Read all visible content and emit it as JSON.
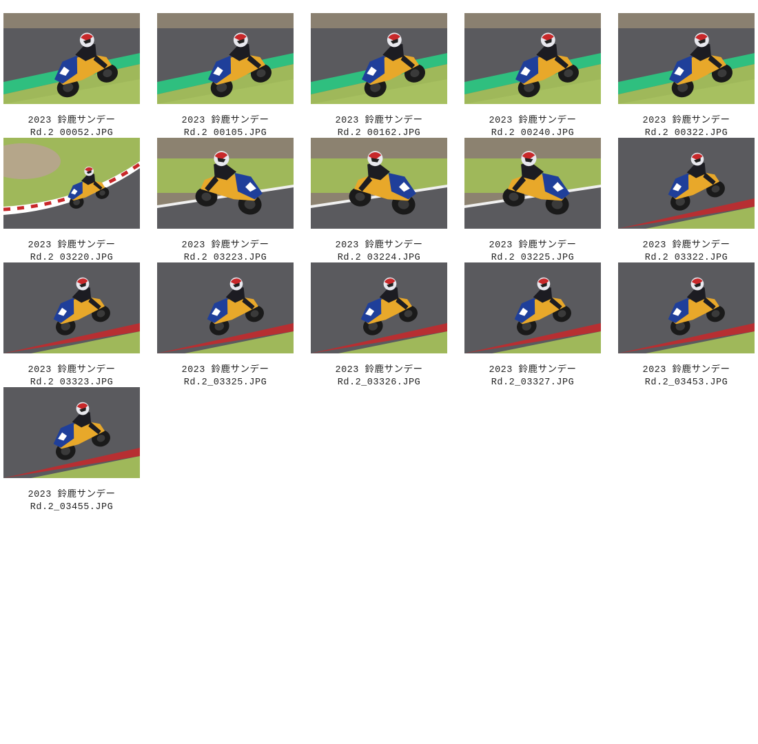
{
  "gallery": {
    "items": [
      {
        "title": "2023 鈴鹿サンデー",
        "file": "Rd.2 00052.JPG",
        "scene": "track-green-kerb-left",
        "lean": "left"
      },
      {
        "title": "2023 鈴鹿サンデー",
        "file": "Rd.2 00105.JPG",
        "scene": "track-green-kerb-left",
        "lean": "left"
      },
      {
        "title": "2023 鈴鹿サンデー",
        "file": "Rd.2 00162.JPG",
        "scene": "track-green-kerb-left",
        "lean": "left"
      },
      {
        "title": "2023 鈴鹿サンデー",
        "file": "Rd.2 00240.JPG",
        "scene": "track-green-kerb-left",
        "lean": "left"
      },
      {
        "title": "2023 鈴鹿サンデー",
        "file": "Rd.2 00322.JPG",
        "scene": "track-green-kerb-left",
        "lean": "left"
      },
      {
        "title": "2023 鈴鹿サンデー",
        "file": "Rd.2 03220.JPG",
        "scene": "grass-corner-red-kerb",
        "lean": "left"
      },
      {
        "title": "2023 鈴鹿サンデー",
        "file": "Rd.2 03223.JPG",
        "scene": "grass-track-side",
        "lean": "right"
      },
      {
        "title": "2023 鈴鹿サンデー",
        "file": "Rd.2 03224.JPG",
        "scene": "grass-track-side",
        "lean": "right"
      },
      {
        "title": "2023 鈴鹿サンデー",
        "file": "Rd.2 03225.JPG",
        "scene": "grass-track-side",
        "lean": "right"
      },
      {
        "title": "2023 鈴鹿サンデー",
        "file": "Rd.2 03322.JPG",
        "scene": "asphalt-red-kerb",
        "lean": "left"
      },
      {
        "title": "2023 鈴鹿サンデー",
        "file": "Rd.2 03323.JPG",
        "scene": "asphalt-red-kerb",
        "lean": "left"
      },
      {
        "title": "2023 鈴鹿サンデー",
        "file": "Rd.2_03325.JPG",
        "scene": "asphalt-red-kerb",
        "lean": "left"
      },
      {
        "title": "2023 鈴鹿サンデー",
        "file": "Rd.2_03326.JPG",
        "scene": "asphalt-red-kerb",
        "lean": "left"
      },
      {
        "title": "2023 鈴鹿サンデー",
        "file": "Rd.2_03327.JPG",
        "scene": "asphalt-red-kerb",
        "lean": "left"
      },
      {
        "title": "2023 鈴鹿サンデー",
        "file": "Rd.2_03453.JPG",
        "scene": "asphalt-red-kerb",
        "lean": "left"
      },
      {
        "title": "2023 鈴鹿サンデー",
        "file": "Rd.2_03455.JPG",
        "scene": "asphalt-red-kerb",
        "lean": "left"
      }
    ]
  },
  "colors": {
    "asphalt": "#5a5a5e",
    "grass": "#9fb85a",
    "green_kerb": "#2fbf7f",
    "bike_blue": "#1f3f9a",
    "bike_yellow": "#e8a82a",
    "kerb_red": "#c8282a",
    "caption_text": "#222222"
  }
}
